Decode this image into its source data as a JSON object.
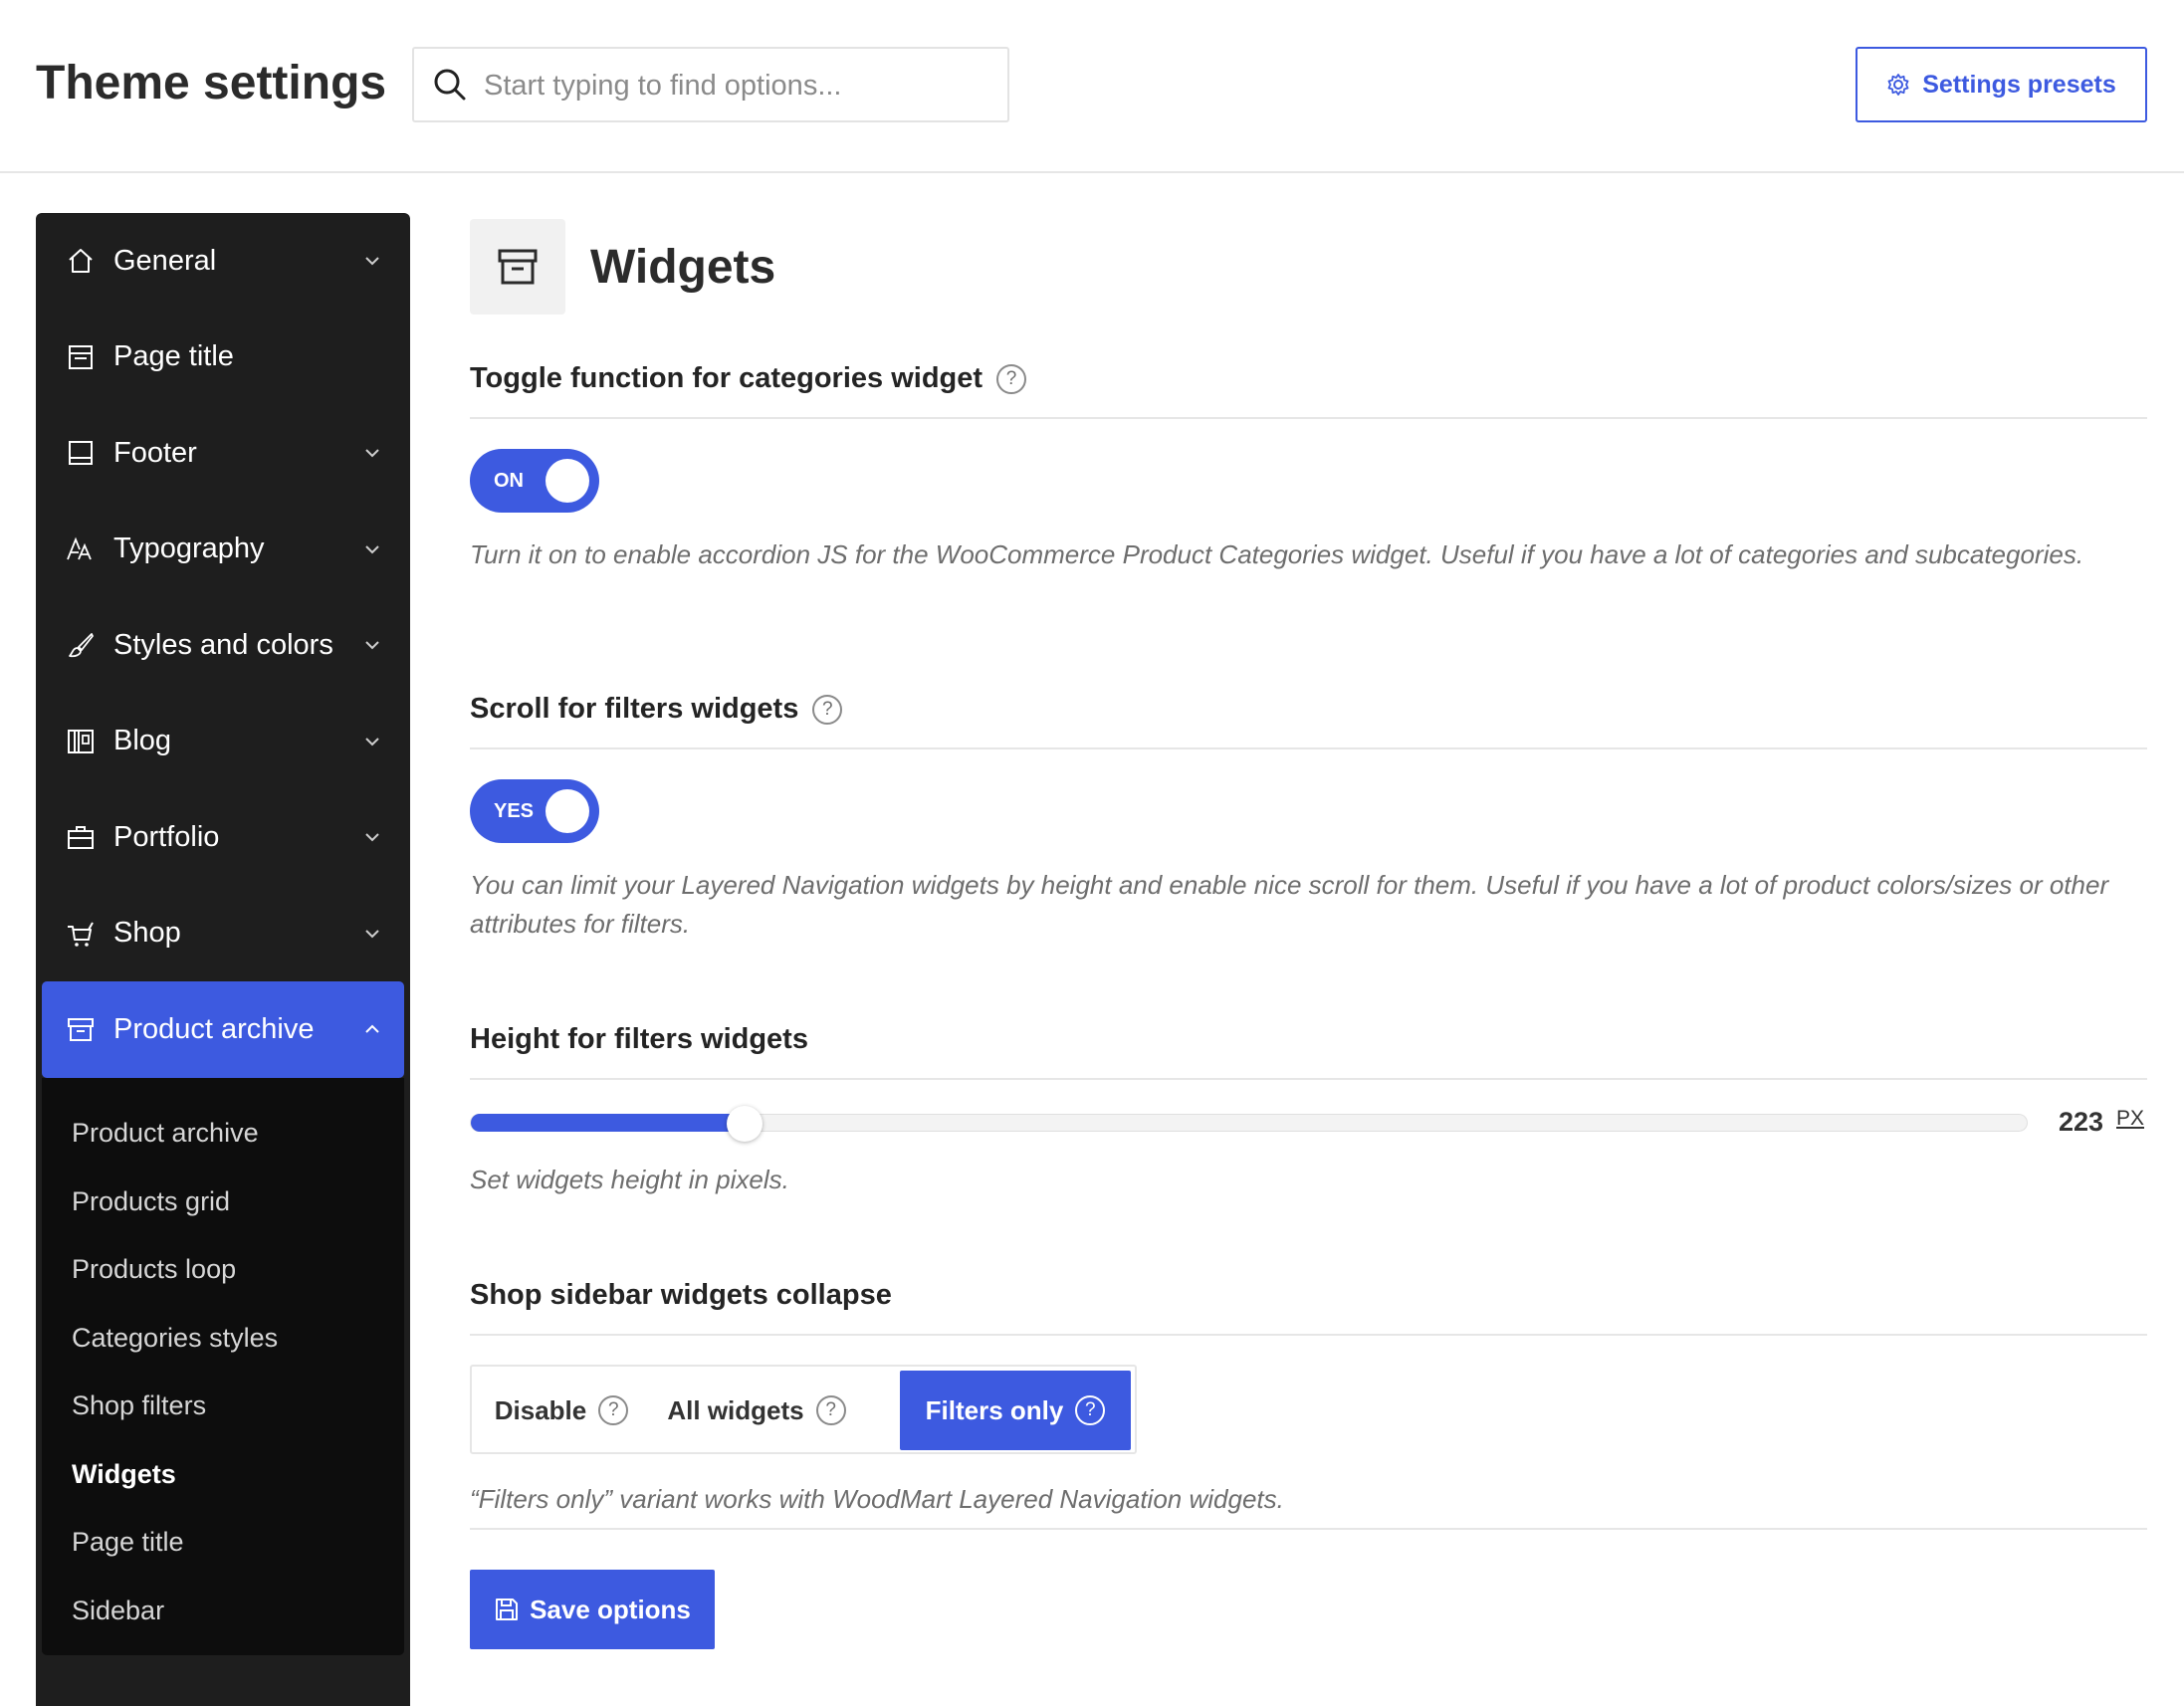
{
  "header": {
    "title": "Theme settings",
    "search_placeholder": "Start typing to find options...",
    "presets_label": "Settings presets"
  },
  "sidebar": {
    "items": [
      {
        "label": "General",
        "icon": "home-icon",
        "has_chevron": true
      },
      {
        "label": "Page title",
        "icon": "page-title-icon",
        "has_chevron": false
      },
      {
        "label": "Footer",
        "icon": "footer-icon",
        "has_chevron": true
      },
      {
        "label": "Typography",
        "icon": "typography-icon",
        "has_chevron": true
      },
      {
        "label": "Styles and colors",
        "icon": "brush-icon",
        "has_chevron": true
      },
      {
        "label": "Blog",
        "icon": "blog-icon",
        "has_chevron": true
      },
      {
        "label": "Portfolio",
        "icon": "briefcase-icon",
        "has_chevron": true
      },
      {
        "label": "Shop",
        "icon": "cart-icon",
        "has_chevron": true
      },
      {
        "label": "Product archive",
        "icon": "archive-icon",
        "has_chevron": true,
        "active": true
      }
    ],
    "submenu": [
      {
        "label": "Product archive"
      },
      {
        "label": "Products grid"
      },
      {
        "label": "Products loop"
      },
      {
        "label": "Categories styles"
      },
      {
        "label": "Shop filters"
      },
      {
        "label": "Widgets",
        "current": true
      },
      {
        "label": "Page title"
      },
      {
        "label": "Sidebar"
      }
    ]
  },
  "section": {
    "title": "Widgets",
    "icon": "archive-icon"
  },
  "options": {
    "toggle_categories": {
      "title": "Toggle function for categories widget",
      "state_label": "ON",
      "description": "Turn it on to enable accordion JS for the WooCommerce Product Categories widget. Useful if you have a lot of categories and subcategories."
    },
    "scroll_filters": {
      "title": "Scroll for filters widgets",
      "state_label": "YES",
      "description": "You can limit your Layered Navigation widgets by height and enable nice scroll for them. Useful if you have a lot of product colors/sizes or other attributes for filters."
    },
    "height_filters": {
      "title": "Height for filters widgets",
      "value": 223,
      "unit": "PX",
      "fill_fraction": 0.176,
      "description": "Set widgets height in pixels."
    },
    "sidebar_collapse": {
      "title": "Shop sidebar widgets collapse",
      "choices": [
        "Disable",
        "All widgets",
        "Filters only"
      ],
      "selected": "Filters only",
      "description": "“Filters only” variant works with WoodMart Layered Navigation widgets."
    }
  },
  "save_label": "Save options",
  "colors": {
    "accent": "#3d5ae0",
    "sidebar_bg": "#1e1e1e",
    "submenu_bg": "#0d0d0d"
  }
}
